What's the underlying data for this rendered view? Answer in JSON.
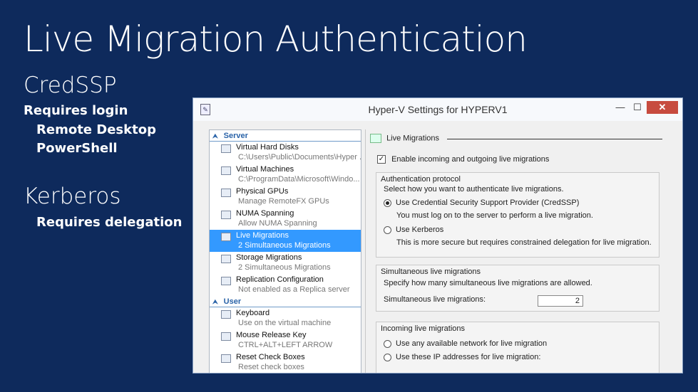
{
  "slide": {
    "title": "Live Migration Authentication",
    "credssp": {
      "heading": "CredSSP",
      "sub": "Requires login",
      "items": [
        "Remote Desktop",
        "PowerShell"
      ]
    },
    "kerberos": {
      "heading": "Kerberos",
      "sub": "Requires delegation"
    }
  },
  "window": {
    "title": "Hyper-V Settings for HYPERV1",
    "minimize": "—",
    "maximize": "☐",
    "close": "✕"
  },
  "nav": {
    "server_section": "Server",
    "user_section": "User",
    "server_items": [
      {
        "label": "Virtual Hard Disks",
        "sub": "C:\\Users\\Public\\Documents\\Hyper ...",
        "icon": "virtual-hard-disks-icon"
      },
      {
        "label": "Virtual Machines",
        "sub": "C:\\ProgramData\\Microsoft\\Windo...",
        "icon": "virtual-machines-icon"
      },
      {
        "label": "Physical GPUs",
        "sub": "Manage RemoteFX GPUs",
        "icon": "physical-gpus-icon"
      },
      {
        "label": "NUMA Spanning",
        "sub": "Allow NUMA Spanning",
        "icon": "numa-spanning-icon"
      },
      {
        "label": "Live Migrations",
        "sub": "2 Simultaneous Migrations",
        "icon": "live-migrations-icon"
      },
      {
        "label": "Storage Migrations",
        "sub": "2 Simultaneous Migrations",
        "icon": "storage-migrations-icon"
      },
      {
        "label": "Replication Configuration",
        "sub": "Not enabled as a Replica server",
        "icon": "replication-icon"
      }
    ],
    "user_items": [
      {
        "label": "Keyboard",
        "sub": "Use on the virtual machine",
        "icon": "keyboard-icon"
      },
      {
        "label": "Mouse Release Key",
        "sub": "CTRL+ALT+LEFT ARROW",
        "icon": "mouse-icon"
      },
      {
        "label": "Reset Check Boxes",
        "sub": "Reset check boxes",
        "icon": "reset-check-icon"
      }
    ]
  },
  "panel": {
    "heading": "Live Migrations",
    "enable_label": "Enable incoming and outgoing live migrations",
    "auth": {
      "title": "Authentication protocol",
      "prompt": "Select how you want to authenticate live migrations.",
      "credssp_label": "Use Credential Security Support Provider (CredSSP)",
      "credssp_desc": "You must log on to the server to perform a live migration.",
      "kerberos_label": "Use Kerberos",
      "kerberos_desc": "This is more secure but requires constrained delegation for live migration."
    },
    "simul": {
      "title": "Simultaneous live migrations",
      "prompt": "Specify how many simultaneous live migrations are allowed.",
      "field_label": "Simultaneous live migrations:",
      "value": "2"
    },
    "incoming": {
      "title": "Incoming live migrations",
      "any_label": "Use any available network for live migration",
      "these_label": "Use these IP addresses for live migration:"
    }
  }
}
